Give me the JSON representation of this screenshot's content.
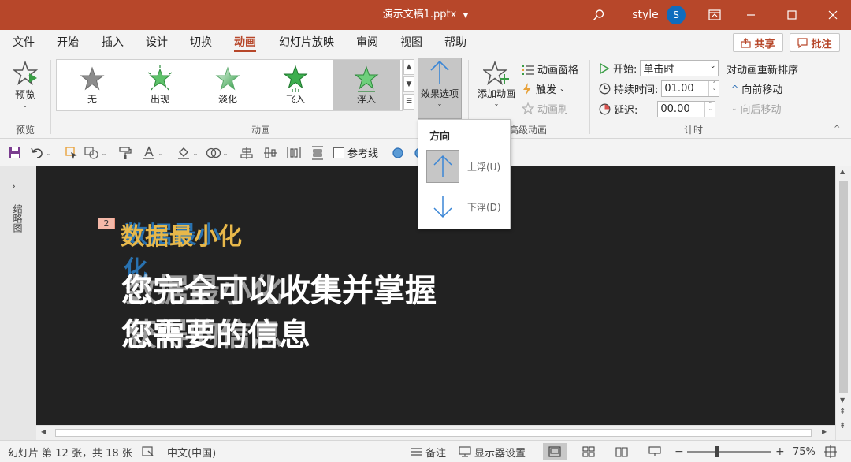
{
  "titlebar": {
    "doc_title": "演示文稿1.pptx",
    "user_name": "style",
    "avatar_initial": "S",
    "accent": "#b7472a"
  },
  "tabs": [
    {
      "label": "文件"
    },
    {
      "label": "开始"
    },
    {
      "label": "插入"
    },
    {
      "label": "设计"
    },
    {
      "label": "切换"
    },
    {
      "label": "动画",
      "active": true
    },
    {
      "label": "幻灯片放映"
    },
    {
      "label": "审阅"
    },
    {
      "label": "视图"
    },
    {
      "label": "帮助"
    }
  ],
  "share_label": "共享",
  "comment_label": "批注",
  "ribbon": {
    "preview": {
      "button_label": "预览",
      "group_label": "预览"
    },
    "animation_gallery": {
      "group_label": "动画",
      "items": [
        {
          "label": "无",
          "icon": "star-gray-icon"
        },
        {
          "label": "出现",
          "icon": "star-burst-icon"
        },
        {
          "label": "淡化",
          "icon": "star-fade-icon"
        },
        {
          "label": "飞入",
          "icon": "star-fly-icon"
        },
        {
          "label": "浮入",
          "icon": "star-float-icon",
          "selected": true
        }
      ]
    },
    "effect_options": {
      "label": "效果选项"
    },
    "advanced": {
      "group_label": "高级动画",
      "add_animation_label": "添加动画",
      "animation_pane_label": "动画窗格",
      "trigger_label": "触发",
      "painter_label": "动画刷"
    },
    "timing": {
      "group_label": "计时",
      "start_label": "开始:",
      "start_value": "单击时",
      "duration_label": "持续时间:",
      "duration_value": "01.00",
      "delay_label": "延迟:",
      "delay_value": "00.00",
      "reorder_label": "对动画重新排序",
      "move_earlier_label": "向前移动",
      "move_later_label": "向后移动"
    }
  },
  "direction_dropdown": {
    "header": "方向",
    "items": [
      {
        "label": "上浮(U)",
        "selected": true
      },
      {
        "label": "下浮(D)"
      }
    ]
  },
  "qat": {
    "reference_line_label": "参考线"
  },
  "left_pane": {
    "label": "缩略图"
  },
  "slide": {
    "badge": "2",
    "title": "数据最小化",
    "title_ghost": "数据最小化",
    "body_lines": [
      "您完全可以收集并掌握",
      "您需要的信息"
    ],
    "body_ghost_lines": [
      "数据最小化",
      "获得的信息"
    ]
  },
  "statusbar": {
    "slide_info": "幻灯片 第 12 张，共 18 张",
    "language": "中文(中国)",
    "notes_label": "备注",
    "display_settings_label": "显示器设置",
    "zoom": "75%",
    "zoom_fraction": 0.75
  }
}
